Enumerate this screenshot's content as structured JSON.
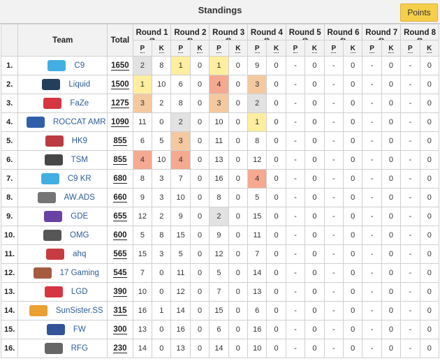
{
  "header": {
    "title": "Standings",
    "points_button": "Points"
  },
  "columns": {
    "team": "Team",
    "total": "Total",
    "rounds": [
      "Round 1",
      "Round 2",
      "Round 3",
      "Round 4",
      "Round 5",
      "Round 6",
      "Round 7",
      "Round 8"
    ],
    "p_label": "P",
    "k_label": "K",
    "info_icon": "i"
  },
  "placement_colors": {
    "1": "#fdeea0",
    "2": "#e2e2e2",
    "3": "#f4c9a0",
    "4": "#f5a990"
  },
  "teams": [
    {
      "rank": "1.",
      "name": "C9",
      "logo": "c9-logo",
      "logo_color": "#2ea5df",
      "total": "1650",
      "rounds": [
        [
          "2",
          "8"
        ],
        [
          "1",
          "0"
        ],
        [
          "1",
          "0"
        ],
        [
          "9",
          "0"
        ],
        [
          "-",
          "0"
        ],
        [
          "-",
          "0"
        ],
        [
          "-",
          "0"
        ],
        [
          "-",
          "0"
        ]
      ]
    },
    {
      "rank": "2.",
      "name": "Liquid",
      "logo": "liquid-logo",
      "logo_color": "#0b2a4a",
      "total": "1500",
      "rounds": [
        [
          "1",
          "10"
        ],
        [
          "6",
          "0"
        ],
        [
          "4",
          "0"
        ],
        [
          "3",
          "0"
        ],
        [
          "-",
          "0"
        ],
        [
          "-",
          "0"
        ],
        [
          "-",
          "0"
        ],
        [
          "-",
          "0"
        ]
      ]
    },
    {
      "rank": "3.",
      "name": "FaZe",
      "logo": "faze-logo",
      "logo_color": "#d0202e",
      "total": "1275",
      "rounds": [
        [
          "3",
          "2"
        ],
        [
          "8",
          "0"
        ],
        [
          "3",
          "0"
        ],
        [
          "2",
          "0"
        ],
        [
          "-",
          "0"
        ],
        [
          "-",
          "0"
        ],
        [
          "-",
          "0"
        ],
        [
          "-",
          "0"
        ]
      ]
    },
    {
      "rank": "4.",
      "name": "ROCCAT AMR",
      "logo": "roccat-logo",
      "logo_color": "#1b4fa0",
      "total": "1090",
      "rounds": [
        [
          "11",
          "0"
        ],
        [
          "2",
          "0"
        ],
        [
          "10",
          "0"
        ],
        [
          "1",
          "0"
        ],
        [
          "-",
          "0"
        ],
        [
          "-",
          "0"
        ],
        [
          "-",
          "0"
        ],
        [
          "-",
          "0"
        ]
      ]
    },
    {
      "rank": "5.",
      "name": "HK9",
      "logo": "hk9-logo",
      "logo_color": "#b3262e",
      "total": "855",
      "rounds": [
        [
          "6",
          "5"
        ],
        [
          "3",
          "0"
        ],
        [
          "11",
          "0"
        ],
        [
          "8",
          "0"
        ],
        [
          "-",
          "0"
        ],
        [
          "-",
          "0"
        ],
        [
          "-",
          "0"
        ],
        [
          "-",
          "0"
        ]
      ]
    },
    {
      "rank": "6.",
      "name": "TSM",
      "logo": "tsm-logo",
      "logo_color": "#333333",
      "total": "855",
      "rounds": [
        [
          "4",
          "10"
        ],
        [
          "4",
          "0"
        ],
        [
          "13",
          "0"
        ],
        [
          "12",
          "0"
        ],
        [
          "-",
          "0"
        ],
        [
          "-",
          "0"
        ],
        [
          "-",
          "0"
        ],
        [
          "-",
          "0"
        ]
      ]
    },
    {
      "rank": "7.",
      "name": "C9 KR",
      "logo": "c9kr-logo",
      "logo_color": "#2ea5df",
      "total": "680",
      "rounds": [
        [
          "8",
          "3"
        ],
        [
          "7",
          "0"
        ],
        [
          "16",
          "0"
        ],
        [
          "4",
          "0"
        ],
        [
          "-",
          "0"
        ],
        [
          "-",
          "0"
        ],
        [
          "-",
          "0"
        ],
        [
          "-",
          "0"
        ]
      ]
    },
    {
      "rank": "8.",
      "name": "AW.ADS",
      "logo": "awads-logo",
      "logo_color": "#666666",
      "total": "660",
      "rounds": [
        [
          "9",
          "3"
        ],
        [
          "10",
          "0"
        ],
        [
          "8",
          "0"
        ],
        [
          "5",
          "0"
        ],
        [
          "-",
          "0"
        ],
        [
          "-",
          "0"
        ],
        [
          "-",
          "0"
        ],
        [
          "-",
          "0"
        ]
      ]
    },
    {
      "rank": "9.",
      "name": "GDE",
      "logo": "gde-logo",
      "logo_color": "#5a2d9c",
      "total": "655",
      "rounds": [
        [
          "12",
          "2"
        ],
        [
          "9",
          "0"
        ],
        [
          "2",
          "0"
        ],
        [
          "15",
          "0"
        ],
        [
          "-",
          "0"
        ],
        [
          "-",
          "0"
        ],
        [
          "-",
          "0"
        ],
        [
          "-",
          "0"
        ]
      ]
    },
    {
      "rank": "10.",
      "name": "OMG",
      "logo": "omg-logo",
      "logo_color": "#444444",
      "total": "600",
      "rounds": [
        [
          "5",
          "8"
        ],
        [
          "15",
          "0"
        ],
        [
          "9",
          "0"
        ],
        [
          "11",
          "0"
        ],
        [
          "-",
          "0"
        ],
        [
          "-",
          "0"
        ],
        [
          "-",
          "0"
        ],
        [
          "-",
          "0"
        ]
      ]
    },
    {
      "rank": "11.",
      "name": "ahq",
      "logo": "ahq-logo",
      "logo_color": "#c0272d",
      "total": "565",
      "rounds": [
        [
          "15",
          "3"
        ],
        [
          "5",
          "0"
        ],
        [
          "12",
          "0"
        ],
        [
          "7",
          "0"
        ],
        [
          "-",
          "0"
        ],
        [
          "-",
          "0"
        ],
        [
          "-",
          "0"
        ],
        [
          "-",
          "0"
        ]
      ]
    },
    {
      "rank": "12.",
      "name": "17 Gaming",
      "logo": "17gaming-logo",
      "logo_color": "#9c4a2a",
      "total": "545",
      "rounds": [
        [
          "7",
          "0"
        ],
        [
          "11",
          "0"
        ],
        [
          "5",
          "0"
        ],
        [
          "14",
          "0"
        ],
        [
          "-",
          "0"
        ],
        [
          "-",
          "0"
        ],
        [
          "-",
          "0"
        ],
        [
          "-",
          "0"
        ]
      ]
    },
    {
      "rank": "13.",
      "name": "LGD",
      "logo": "lgd-logo",
      "logo_color": "#d0202e",
      "total": "390",
      "rounds": [
        [
          "10",
          "0"
        ],
        [
          "12",
          "0"
        ],
        [
          "7",
          "0"
        ],
        [
          "13",
          "0"
        ],
        [
          "-",
          "0"
        ],
        [
          "-",
          "0"
        ],
        [
          "-",
          "0"
        ],
        [
          "-",
          "0"
        ]
      ]
    },
    {
      "rank": "14.",
      "name": "SunSister.SS",
      "logo": "sunsister-logo",
      "logo_color": "#e8961c",
      "total": "315",
      "rounds": [
        [
          "16",
          "1"
        ],
        [
          "14",
          "0"
        ],
        [
          "15",
          "0"
        ],
        [
          "6",
          "0"
        ],
        [
          "-",
          "0"
        ],
        [
          "-",
          "0"
        ],
        [
          "-",
          "0"
        ],
        [
          "-",
          "0"
        ]
      ]
    },
    {
      "rank": "15.",
      "name": "FW",
      "logo": "fw-logo",
      "logo_color": "#1d3f8f",
      "total": "300",
      "rounds": [
        [
          "13",
          "0"
        ],
        [
          "16",
          "0"
        ],
        [
          "6",
          "0"
        ],
        [
          "16",
          "0"
        ],
        [
          "-",
          "0"
        ],
        [
          "-",
          "0"
        ],
        [
          "-",
          "0"
        ],
        [
          "-",
          "0"
        ]
      ]
    },
    {
      "rank": "16.",
      "name": "RFG",
      "logo": "rfg-logo",
      "logo_color": "#555555",
      "total": "230",
      "rounds": [
        [
          "14",
          "0"
        ],
        [
          "13",
          "0"
        ],
        [
          "14",
          "0"
        ],
        [
          "10",
          "0"
        ],
        [
          "-",
          "0"
        ],
        [
          "-",
          "0"
        ],
        [
          "-",
          "0"
        ],
        [
          "-",
          "0"
        ]
      ]
    }
  ]
}
